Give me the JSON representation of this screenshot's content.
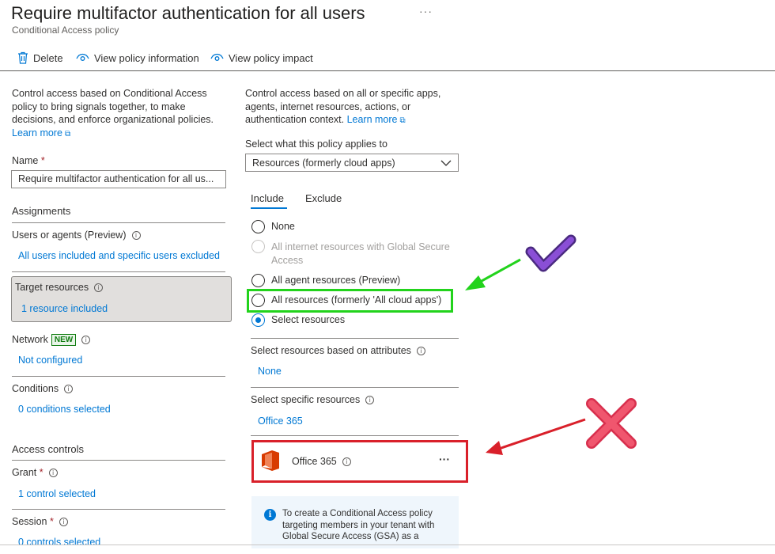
{
  "header": {
    "title": "Require multifactor authentication for all users",
    "subtitle": "Conditional Access policy",
    "more": "···"
  },
  "toolbar": {
    "delete_label": "Delete",
    "view_info_label": "View policy information",
    "view_impact_label": "View policy impact"
  },
  "left": {
    "description": "Control access based on Conditional Access policy to bring signals together, to make decisions, and enforce organizational policies.",
    "learn_more": "Learn more",
    "name_label": "Name",
    "required_mark": "*",
    "name_value": "Require multifactor authentication for all us...",
    "assignments_heading": "Assignments",
    "users_label": "Users or agents (Preview)",
    "users_value": "All users included and specific users excluded",
    "target_label": "Target resources",
    "target_value": "1 resource included",
    "network_label": "Network",
    "network_badge": "NEW",
    "network_value": "Not configured",
    "conditions_label": "Conditions",
    "conditions_value": "0 conditions selected",
    "access_controls_heading": "Access controls",
    "grant_label": "Grant",
    "grant_value": "1 control selected",
    "session_label": "Session",
    "session_value": "0 controls selected"
  },
  "right": {
    "description": "Control access based on all or specific apps, agents, internet resources, actions, or authentication context.",
    "learn_more": "Learn more",
    "applies_label": "Select what this policy applies to",
    "applies_value": "Resources (formerly cloud apps)",
    "tabs": [
      "Include",
      "Exclude"
    ],
    "active_tab": "Include",
    "options": {
      "none": "None",
      "internet": "All internet resources with Global Secure Access",
      "agent": "All agent resources (Preview)",
      "all": "All resources (formerly 'All cloud apps')",
      "select": "Select resources"
    },
    "selected_option": "Select resources",
    "attributes_label": "Select resources based on attributes",
    "attributes_value": "None",
    "specific_label": "Select specific resources",
    "specific_value": "Office 365",
    "app_name": "Office 365",
    "app_more": "···",
    "info_text": "To create a Conditional Access policy targeting members in your tenant with Global Secure Access (GSA) as a"
  },
  "annotations": {
    "green_color": "#22d31c",
    "red_color": "#d9202a",
    "check_color": "#7b3fc4",
    "cross_color": "#f0566e"
  }
}
